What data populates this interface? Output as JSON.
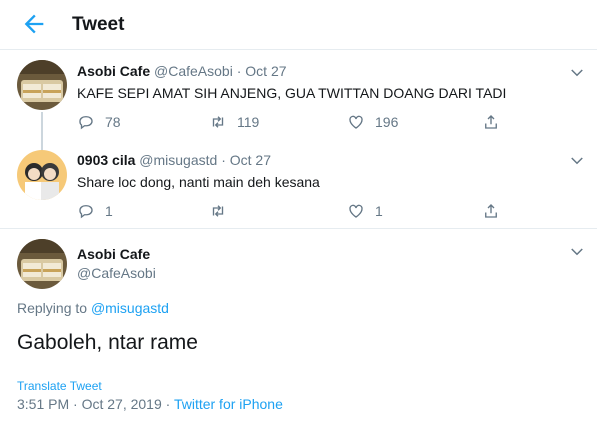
{
  "header": {
    "title": "Tweet",
    "back_icon": "arrow-left-icon",
    "accent_color": "#1da1f2"
  },
  "tweets": [
    {
      "name": "Asobi Cafe",
      "handle": "@CafeAsobi",
      "separator": "·",
      "date": "Oct 27",
      "text": "KAFE SEPI AMAT SIH ANJENG, GUA TWITTAN DOANG DARI TADI",
      "replies": "78",
      "retweets": "119",
      "likes": "196"
    },
    {
      "name": "0903 cila",
      "handle": "@misugastd",
      "separator": "·",
      "date": "Oct 27",
      "text": "Share loc dong, nanti main deh kesana",
      "replies": "1",
      "retweets": "",
      "likes": "1"
    }
  ],
  "main_tweet": {
    "name": "Asobi Cafe",
    "handle": "@CafeAsobi",
    "replying_prefix": "Replying to",
    "replying_to": "@misugastd",
    "text": "Gaboleh, ntar rame",
    "translate_label": "Translate Tweet",
    "timestamp": "3:51 PM · Oct 27, 2019 ·",
    "source": "Twitter for iPhone"
  },
  "icons": {
    "reply": "reply-icon",
    "retweet": "retweet-icon",
    "like": "heart-icon",
    "share": "share-icon",
    "more": "chevron-down-icon"
  }
}
